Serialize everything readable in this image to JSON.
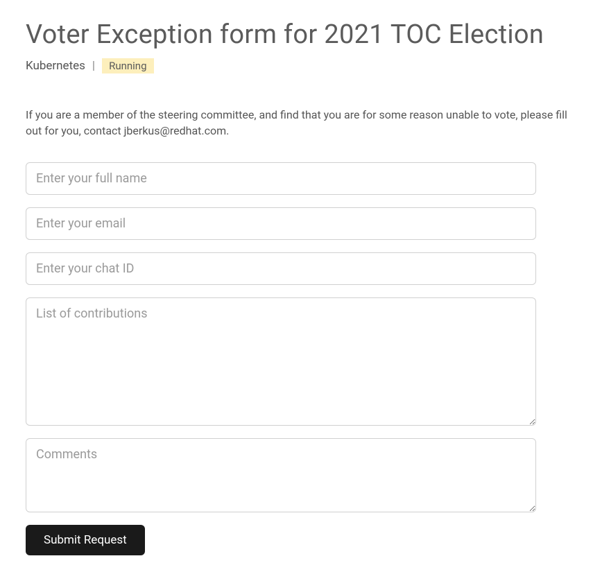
{
  "header": {
    "title": "Voter Exception form for 2021 TOC Election",
    "project": "Kubernetes",
    "separator": "|",
    "status": "Running"
  },
  "description": "If you are a member of the steering committee, and find that you are for some reason unable to vote, please fill out for you, contact jberkus@redhat.com.",
  "form": {
    "fullname_placeholder": "Enter your full name",
    "email_placeholder": "Enter your email",
    "chatid_placeholder": "Enter your chat ID",
    "contributions_placeholder": "List of contributions",
    "comments_placeholder": "Comments",
    "submit_label": "Submit Request"
  }
}
